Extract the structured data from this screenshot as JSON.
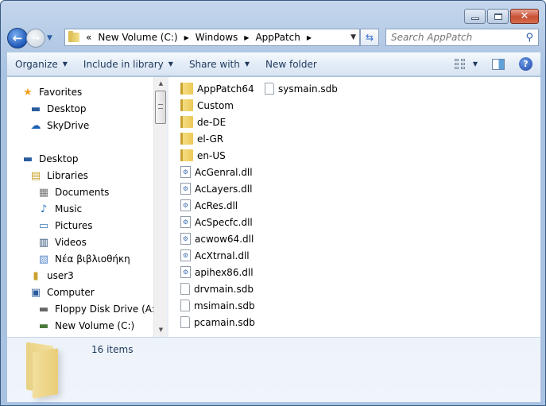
{
  "window": {
    "caption_buttons": {
      "minimize": "minimize",
      "maximize": "maximize",
      "close": "close"
    }
  },
  "navigation": {
    "back_icon": "←",
    "forward_icon": "→",
    "history_dropdown": "▼"
  },
  "address_bar": {
    "overflow": "«",
    "breadcrumbs": [
      "New Volume (C:)",
      "Windows",
      "AppPatch"
    ],
    "separator": "▶",
    "dropdown": "▼"
  },
  "refresh_icon": "⇆",
  "search": {
    "placeholder": "Search AppPatch",
    "icon": "⚲"
  },
  "toolbar": {
    "organize": "Organize",
    "include_in_library": "Include in library",
    "share_with": "Share with",
    "new_folder": "New folder",
    "dropdown": "▼",
    "help": "?"
  },
  "nav_pane": {
    "items": [
      {
        "label": "Favorites",
        "icon": "★",
        "color": "#f0a020"
      },
      {
        "label": "Desktop",
        "icon": "▬",
        "color": "#2a5c9e"
      },
      {
        "label": "SkyDrive",
        "icon": "☁",
        "color": "#1e5fb0"
      },
      {
        "label": "Desktop",
        "icon": "▬",
        "color": "#2a5c9e"
      },
      {
        "label": "Libraries",
        "icon": "▤",
        "color": "#c9a22e"
      },
      {
        "label": "Documents",
        "icon": "▦",
        "color": "#777777"
      },
      {
        "label": "Music",
        "icon": "♪",
        "color": "#1e6fc8"
      },
      {
        "label": "Pictures",
        "icon": "▭",
        "color": "#3a7ab8"
      },
      {
        "label": "Videos",
        "icon": "▥",
        "color": "#335577"
      },
      {
        "label": "Νέα βιβλιοθήκη",
        "icon": "▧",
        "color": "#5a8ac8"
      },
      {
        "label": "user3",
        "icon": "▮",
        "color": "#c9a22e"
      },
      {
        "label": "Computer",
        "icon": "▣",
        "color": "#2a5c9e"
      },
      {
        "label": "Floppy Disk Drive (A:)",
        "icon": "▬",
        "color": "#666666"
      },
      {
        "label": "New Volume (C:)",
        "icon": "▬",
        "color": "#4a7a3a"
      }
    ],
    "scroll_up": "▲",
    "scroll_down": "▼"
  },
  "files": [
    {
      "name": "AppPatch64",
      "type": "folder"
    },
    {
      "name": "Custom",
      "type": "folder"
    },
    {
      "name": "de-DE",
      "type": "folder"
    },
    {
      "name": "el-GR",
      "type": "folder"
    },
    {
      "name": "en-US",
      "type": "folder"
    },
    {
      "name": "AcGenral.dll",
      "type": "dll"
    },
    {
      "name": "AcLayers.dll",
      "type": "dll"
    },
    {
      "name": "AcRes.dll",
      "type": "dll"
    },
    {
      "name": "AcSpecfc.dll",
      "type": "dll"
    },
    {
      "name": "acwow64.dll",
      "type": "dll"
    },
    {
      "name": "AcXtrnal.dll",
      "type": "dll"
    },
    {
      "name": "apihex86.dll",
      "type": "dll"
    },
    {
      "name": "drvmain.sdb",
      "type": "sdb"
    },
    {
      "name": "msimain.sdb",
      "type": "sdb"
    },
    {
      "name": "pcamain.sdb",
      "type": "sdb"
    },
    {
      "name": "sysmain.sdb",
      "type": "sdb"
    }
  ],
  "details_pane": {
    "item_count": "16 items"
  }
}
